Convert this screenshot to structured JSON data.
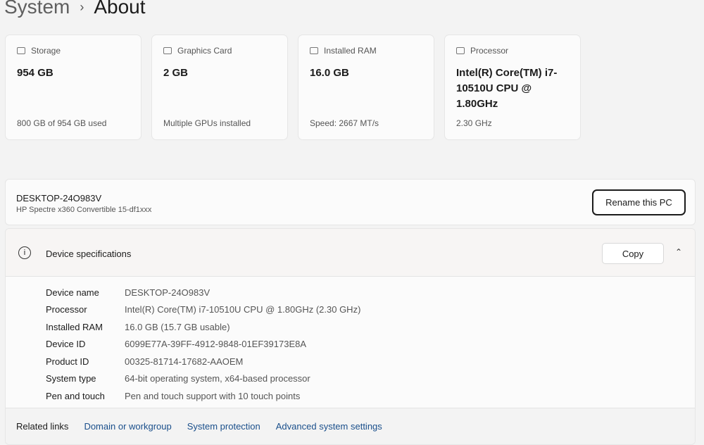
{
  "breadcrumb": {
    "parent": "System",
    "current": "About"
  },
  "cards": [
    {
      "icon": "storage-icon",
      "label": "Storage",
      "value": "954 GB",
      "sub": "800 GB of 954 GB used"
    },
    {
      "icon": "graphics-card-icon",
      "label": "Graphics Card",
      "value": "2 GB",
      "sub": "Multiple GPUs installed"
    },
    {
      "icon": "ram-icon",
      "label": "Installed RAM",
      "value": "16.0 GB",
      "sub": "Speed: 2667 MT/s"
    },
    {
      "icon": "processor-icon",
      "label": "Processor",
      "value": "Intel(R) Core(TM) i7-10510U CPU @ 1.80GHz",
      "sub": "2.30 GHz"
    }
  ],
  "pc": {
    "name": "DESKTOP-24O983V",
    "model": "HP Spectre x360 Convertible 15-df1xxx",
    "rename_label": "Rename this PC"
  },
  "specs": {
    "title": "Device specifications",
    "copy_label": "Copy",
    "rows": [
      {
        "k": "Device name",
        "v": "DESKTOP-24O983V"
      },
      {
        "k": "Processor",
        "v": "Intel(R) Core(TM) i7-10510U CPU @ 1.80GHz (2.30 GHz)"
      },
      {
        "k": "Installed RAM",
        "v": "16.0 GB (15.7 GB usable)"
      },
      {
        "k": "Device ID",
        "v": "6099E77A-39FF-4912-9848-01EF39173E8A"
      },
      {
        "k": "Product ID",
        "v": "00325-81714-17682-AAOEM"
      },
      {
        "k": "System type",
        "v": "64-bit operating system, x64-based processor"
      },
      {
        "k": "Pen and touch",
        "v": "Pen and touch support with 10 touch points"
      }
    ]
  },
  "related": {
    "label": "Related links",
    "links": [
      "Domain or workgroup",
      "System protection",
      "Advanced system settings"
    ]
  }
}
